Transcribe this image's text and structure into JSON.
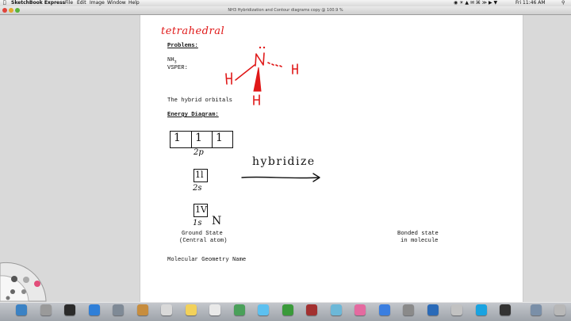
{
  "menubar": {
    "app_name": "SketchBook Express",
    "menus": [
      "File",
      "Edit",
      "Image",
      "Window",
      "Help"
    ],
    "clock": "Fri 11:46 AM"
  },
  "window": {
    "title": "NH3 Hybridization and Contour diagrams copy @ 100.9 %"
  },
  "document": {
    "handwritten_title": "tetrahedral",
    "problems_heading": "Problems:",
    "nh3_label": "NH",
    "nh3_subscript": "3",
    "vsper_label": "VSPER:",
    "hybrid_orbitals": "The hybrid orbitals",
    "energy_heading": "Energy Diagram:",
    "molecule_atoms": {
      "center": "N",
      "left": "H",
      "right": "H",
      "bottom": "H"
    },
    "orbitals": {
      "p_label": "2p",
      "p_slots": [
        "1",
        "1",
        "1"
      ],
      "s2_label": "2s",
      "s2_slot": "1l",
      "s1_label": "1s",
      "s1_slot": "1V",
      "element_mark": "N"
    },
    "hybridize_label": "hybridize",
    "ground_state_line1": "Ground State",
    "ground_state_line2": "(Central atom)",
    "bonded_state_line1": "Bonded state",
    "bonded_state_line2": "in molecule",
    "molecular_geometry": "Molecular Geometry Name"
  },
  "colors": {
    "ink_red": "#e01818",
    "ink_black": "#111111",
    "canvas": "#ffffff"
  },
  "dock": {
    "icons": [
      "finder-icon",
      "launchpad-icon",
      "mission-control-icon",
      "safari-icon",
      "mail-icon",
      "contacts-icon",
      "calendar-icon",
      "notes-icon",
      "reminders-icon",
      "maps-icon",
      "messages-icon",
      "facetime-icon",
      "photo-booth-icon",
      "iphoto-icon",
      "itunes-icon",
      "app-store-icon",
      "system-preferences-icon",
      "quicktime-icon",
      "preview-icon",
      "skype-icon",
      "sketchbook-icon",
      "downloads-icon",
      "trash-icon"
    ]
  }
}
